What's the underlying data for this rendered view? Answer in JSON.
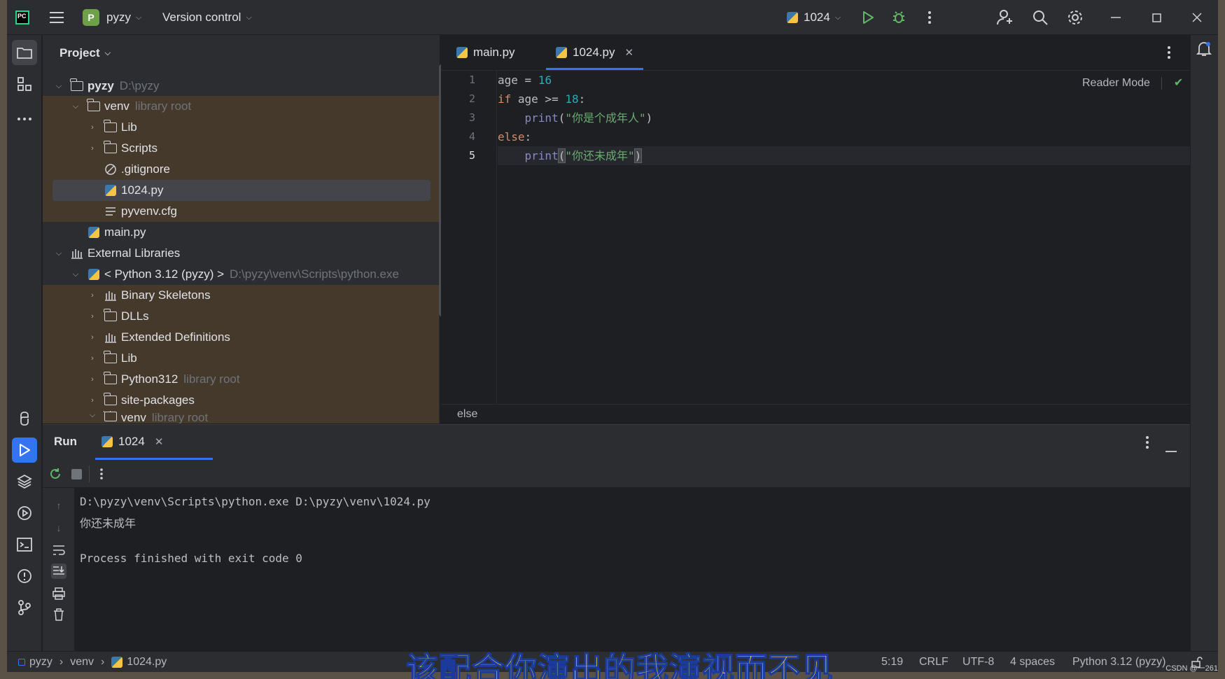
{
  "titlebar": {
    "logo": "PC",
    "menu_icon": "hamburger-menu-icon",
    "project_badge": "P",
    "project_name": "pyzy",
    "vcs_label": "Version control",
    "run_config": "1024"
  },
  "project_panel": {
    "title": "Project",
    "rows": [
      {
        "name": "pyzy",
        "hint": "D:\\pyzy"
      },
      {
        "name": "venv",
        "hint": "library root"
      },
      {
        "name": "Lib"
      },
      {
        "name": "Scripts"
      },
      {
        "name": ".gitignore"
      },
      {
        "name": "1024.py"
      },
      {
        "name": "pyvenv.cfg"
      },
      {
        "name": "main.py"
      },
      {
        "name": "External Libraries"
      },
      {
        "name": "< Python 3.12 (pyzy) >",
        "hint": "D:\\pyzy\\venv\\Scripts\\python.exe"
      },
      {
        "name": "Binary Skeletons"
      },
      {
        "name": "DLLs"
      },
      {
        "name": "Extended Definitions"
      },
      {
        "name": "Lib"
      },
      {
        "name": "Python312",
        "hint": "library root"
      },
      {
        "name": "site-packages"
      },
      {
        "name": "venv",
        "hint": "library root"
      }
    ]
  },
  "editor": {
    "tabs": [
      {
        "label": "main.py"
      },
      {
        "label": "1024.py"
      }
    ],
    "reader_mode": "Reader Mode",
    "line_numbers": [
      "1",
      "2",
      "3",
      "4",
      "5"
    ],
    "code": {
      "l1": {
        "a": "age",
        "b": " = ",
        "c": "16"
      },
      "l2": {
        "a": "if",
        "b": " age >= ",
        "c": "18",
        "d": ":"
      },
      "l3": {
        "a": "    ",
        "b": "print",
        "c": "(",
        "d": "\"你是个成年人\"",
        "e": ")"
      },
      "l4": {
        "a": "else",
        "b": ":"
      },
      "l5": {
        "a": "    ",
        "b": "print",
        "c": "(",
        "d": "\"你还未成年\"",
        "e": ")"
      }
    },
    "breadcrumb": "else"
  },
  "run_panel": {
    "title": "Run",
    "tab_label": "1024",
    "console": [
      "D:\\pyzy\\venv\\Scripts\\python.exe D:\\pyzy\\venv\\1024.py",
      "你还未成年",
      "",
      "Process finished with exit code 0"
    ]
  },
  "statusbar": {
    "crumbs": [
      "pyzy",
      "venv",
      "1024.py"
    ],
    "position": "5:19",
    "line_sep": "CRLF",
    "encoding": "UTF-8",
    "indent": "4 spaces",
    "interpreter": "Python 3.12 (pyzy)"
  },
  "overlay": {
    "subtitle": "该配合你演出的我演视而不见",
    "watermark": "CSDN @一261"
  },
  "colors": {
    "accent": "#3574f0",
    "excluded_bg": "#45392b",
    "run_green": "#5fb865"
  }
}
